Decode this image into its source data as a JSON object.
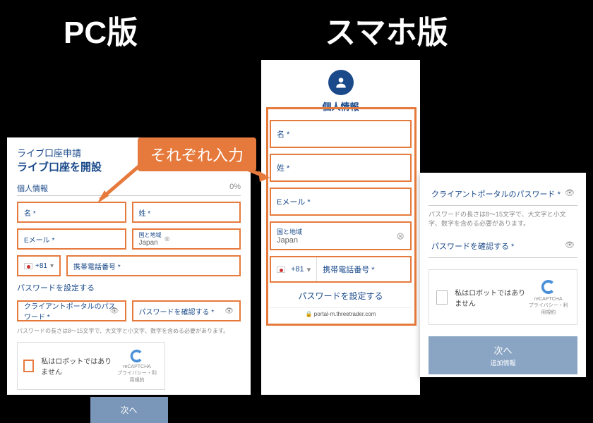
{
  "headers": {
    "pc": "PC版",
    "sp": "スマホ版"
  },
  "callout": "それぞれ入力",
  "pc": {
    "title1": "ライブ口座申請",
    "title2": "ライブ口座を開設",
    "section": "個人情報",
    "percent": "0%",
    "first_name": "名 *",
    "last_name": "姓 *",
    "email": "Eメール *",
    "country_lbl": "国と地域",
    "country_val": "Japan",
    "dial": "+81",
    "phone": "携帯電話番号 *",
    "pw_section": "パスワードを設定する",
    "pw_portal": "クライアントポータルのパスワード *",
    "pw_confirm": "パスワードを確認する *",
    "pw_hint": "パスワードの長さは8〜15文字で、大文字と小文字、数字を含める必要があります。",
    "recaptcha": "私はロボットではありません",
    "recaptcha_brand": "reCAPTCHA",
    "recaptcha_sub": "プライバシー・利用規約",
    "next": "次へ"
  },
  "sp1": {
    "title": "個人情報",
    "first_name": "名 *",
    "last_name": "姓 *",
    "email": "Eメール *",
    "country_lbl": "国と地域",
    "country_val": "Japan",
    "dial": "+81",
    "phone": "携帯電話番号 *",
    "pw_section": "パスワードを設定する",
    "url": "portal-m.threetrader.com"
  },
  "sp2": {
    "pw_portal": "クライアントポータルのパスワード *",
    "pw_hint": "パスワードの長さは8〜15文字で、大文字と小文字、数字を含める必要があります。",
    "pw_confirm": "パスワードを確認する *",
    "recaptcha": "私はロボットではありません",
    "recaptcha_brand": "reCAPTCHA",
    "recaptcha_sub": "プライバシー・利用規約",
    "next": "次へ",
    "next_sub": "追加情報"
  }
}
